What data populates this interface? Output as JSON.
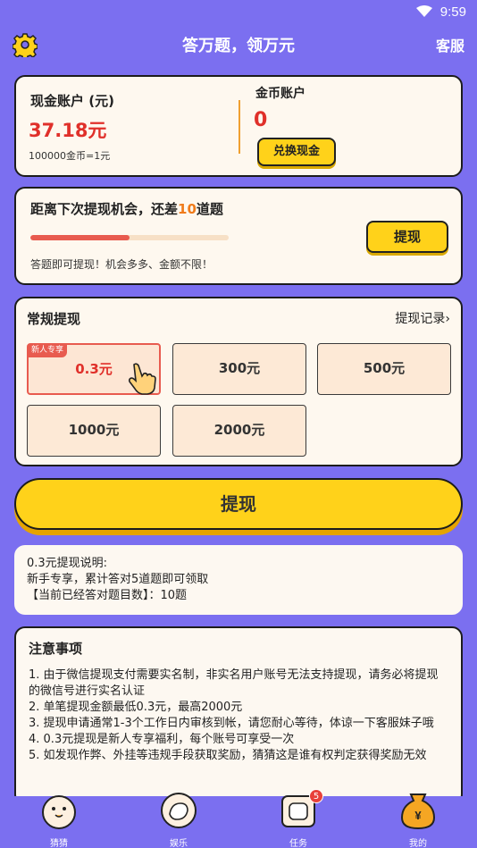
{
  "status": {
    "time": "9:59"
  },
  "header": {
    "title": "答万题，领万元",
    "service": "客服"
  },
  "account": {
    "cash_label": "现金账户 (元)",
    "cash_value": "37.18元",
    "rate": "100000金币=1元",
    "coin_label": "金币账户",
    "coin_value": "0",
    "exchange_button": "兑换现金"
  },
  "progress": {
    "text_prefix": "距离下次提现机会，还差",
    "remaining": "10",
    "text_suffix": "道题",
    "progress_fraction": 0.5,
    "tip": "答题即可提现！机会多多、金额不限！",
    "button": "提现"
  },
  "regular": {
    "title": "常规提现",
    "records": "提现记录",
    "badge": "新人专享",
    "amounts": [
      "0.3元",
      "300元",
      "500元",
      "1000元",
      "2000元"
    ]
  },
  "withdraw_button": "提现",
  "explanation": {
    "line1": "0.3元提现说明:",
    "line2": "新手专享，累计答对5道题即可领取",
    "line3": "【当前已经答对题目数】：10题"
  },
  "notes": {
    "title": "注意事项",
    "items": [
      "1. 由于微信提现支付需要实名制，非实名用户账号无法支持提现，请务必将提现的微信号进行实名认证",
      "2. 单笔提现金额最低0.3元，最高2000元",
      "3. 提现申请通常1-3个工作日内审核到帐，请您耐心等待，体谅一下客服妹子哦",
      "4. 0.3元提现是新人专享福利，每个账号可享受一次",
      "5. 如发现作弊、外挂等违规手段获取奖励，猜猜这是谁有权判定获得奖励无效"
    ]
  },
  "nav": {
    "items": [
      {
        "label": "猜猜",
        "icon": "chick-icon"
      },
      {
        "label": "娱乐",
        "icon": "leaf-icon"
      },
      {
        "label": "任务",
        "icon": "calendar-icon",
        "badge": "5"
      },
      {
        "label": "我的",
        "icon": "money-bag-icon"
      }
    ]
  },
  "colors": {
    "background": "#7b6ff0",
    "accent_yellow": "#ffd21a",
    "accent_red": "#e0302a"
  }
}
